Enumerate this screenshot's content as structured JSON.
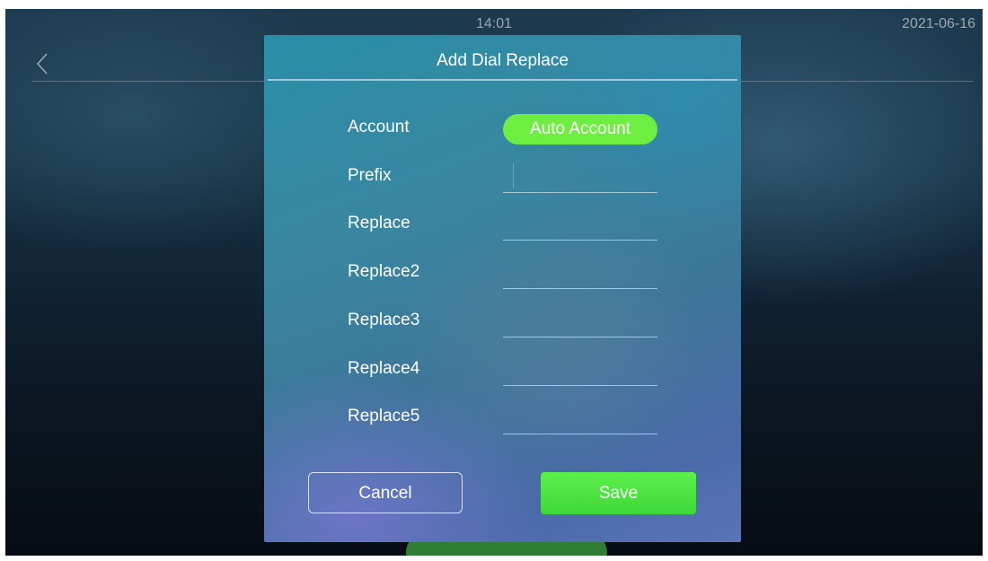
{
  "status_bar": {
    "time": "14:01",
    "date": "2021-06-16"
  },
  "navigation": {
    "back_icon": "chevron-left-icon"
  },
  "dialog": {
    "title": "Add Dial Replace",
    "account": {
      "label": "Account",
      "value": "Auto Account"
    },
    "fields": [
      {
        "label": "Prefix",
        "value": ""
      },
      {
        "label": "Replace",
        "value": ""
      },
      {
        "label": "Replace2",
        "value": ""
      },
      {
        "label": "Replace3",
        "value": ""
      },
      {
        "label": "Replace4",
        "value": ""
      },
      {
        "label": "Replace5",
        "value": ""
      }
    ],
    "cancel_label": "Cancel",
    "save_label": "Save"
  },
  "colors": {
    "accent_green": "#6dee41",
    "save_green": "#3fd83a",
    "cursor": "#c98080"
  }
}
